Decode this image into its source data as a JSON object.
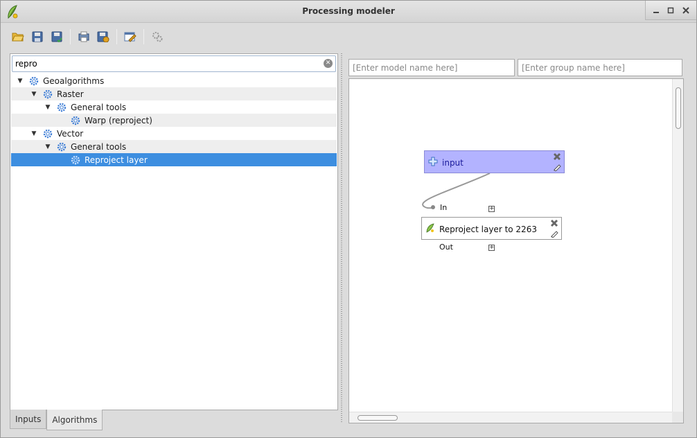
{
  "window": {
    "title": "Processing modeler",
    "controls": [
      "minimize",
      "maximize",
      "close"
    ]
  },
  "toolbar": {
    "buttons": [
      {
        "name": "open-model-button",
        "icon": "folder-open-icon"
      },
      {
        "name": "save-model-button",
        "icon": "floppy-icon"
      },
      {
        "name": "save-as-button",
        "icon": "floppy-save-as-icon"
      },
      {
        "name": "export-image-button",
        "icon": "export-image-icon"
      },
      {
        "name": "export-python-button",
        "icon": "export-python-icon"
      },
      {
        "name": "edit-help-button",
        "icon": "edit-help-icon"
      },
      {
        "name": "run-model-button",
        "icon": "run-gears-icon"
      }
    ]
  },
  "search": {
    "value": "repro"
  },
  "tree": [
    {
      "label": "Geoalgorithms",
      "level": 0,
      "expanded": true
    },
    {
      "label": "Raster",
      "level": 1,
      "expanded": true
    },
    {
      "label": "General tools",
      "level": 2,
      "expanded": true
    },
    {
      "label": "Warp (reproject)",
      "level": 3,
      "leaf": true
    },
    {
      "label": "Vector",
      "level": 1,
      "expanded": true
    },
    {
      "label": "General tools",
      "level": 2,
      "expanded": true
    },
    {
      "label": "Reproject layer",
      "level": 3,
      "leaf": true,
      "selected": true
    }
  ],
  "tabs": [
    {
      "label": "Inputs",
      "active": false
    },
    {
      "label": "Algorithms",
      "active": true
    }
  ],
  "model": {
    "name_placeholder": "[Enter model name here]",
    "group_placeholder": "[Enter group name here]"
  },
  "canvas": {
    "input_node": {
      "label": "input"
    },
    "algorithm_node": {
      "label": "Reproject layer to 2263",
      "in_label": "In",
      "out_label": "Out"
    },
    "colors": {
      "input_fill": "#b3b3ff",
      "selection": "#3d8ee0"
    }
  }
}
